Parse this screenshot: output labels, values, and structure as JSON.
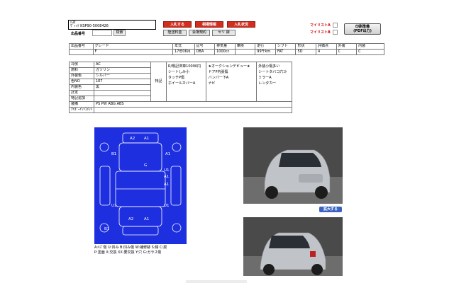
{
  "header": {
    "maker": "ﾄﾖﾀ",
    "model": "ｳﾞｨｯﾂ KSP90-5008426",
    "lot_label": "出品番号",
    "search_label": "検索"
  },
  "buttons": {
    "bid": "入札する",
    "market": "相場情報",
    "status": "入札状況",
    "past_results": "陸送料金",
    "venue_rules": "会場規約",
    "seri": "セリ 録",
    "mylist_a": "マイリストA",
    "mylist_b": "マイリストB",
    "print_line1": "印刷準備",
    "print_line2": "(PDF出力)",
    "expand": "拡大する"
  },
  "main_table": {
    "headers": [
      "出品番号",
      "グレード",
      "年式",
      "記号",
      "排気量",
      "車検",
      "走行",
      "シフト",
      "形状",
      "評価点",
      "外装",
      "内装"
    ],
    "values": [
      "",
      "F",
      "17年06月",
      "DBA",
      "1000cc",
      "",
      "99千km",
      "FAT",
      "5D",
      "4",
      "C",
      "C"
    ]
  },
  "specs": [
    {
      "k": "冷房",
      "v": "AC"
    },
    {
      "k": "燃料",
      "v": "ガソリン"
    },
    {
      "k": "外装色",
      "v": "シルバー"
    },
    {
      "k": "色NO",
      "v": "1E7"
    },
    {
      "k": "内装色",
      "v": "黒"
    },
    {
      "k": "計定",
      "v": ""
    },
    {
      "k": "特記追加",
      "v": ""
    }
  ],
  "features_label": "特記",
  "features": {
    "col1": [
      "R/規記済車10090円",
      "シートしみ小",
      "タッチP傷",
      "ホイールカバーA"
    ],
    "col2": [
      "★オークションデビュー★",
      "ドアP内張傷",
      "バンパー下A",
      "ナビ"
    ],
    "col3": [
      "外装小傷多い",
      "シートタバコ穴ｺｹ",
      "ミラーA",
      "",
      "",
      "レンタカー"
    ]
  },
  "equipment_label": "装備",
  "equipment": "PS PW ABG ABS",
  "ipoint_label": "ｱｲﾎﾟｰｲﾝﾄｺﾒﾝﾄ",
  "diagram_labels": [
    "A2",
    "A1",
    "B1",
    "A1",
    "G",
    "U1",
    "A1",
    "A1",
    "U1",
    "U1",
    "B1",
    "A2",
    "A1"
  ],
  "legend": {
    "line1": "A:ｷｽﾞ傷   U:凹み   B:凹み傷   W:補修跡   S:錆   C:腐",
    "line2": "P:塗面   X:交換   XX:要交換   Y:穴   G:ガラス傷"
  },
  "colors": {
    "bid": "#d42c1e",
    "market": "#d42c1e",
    "status": "#d42c1e",
    "panel": "#1e2fe0",
    "mylist": "#cc0000",
    "car": "#c0c4c8"
  }
}
